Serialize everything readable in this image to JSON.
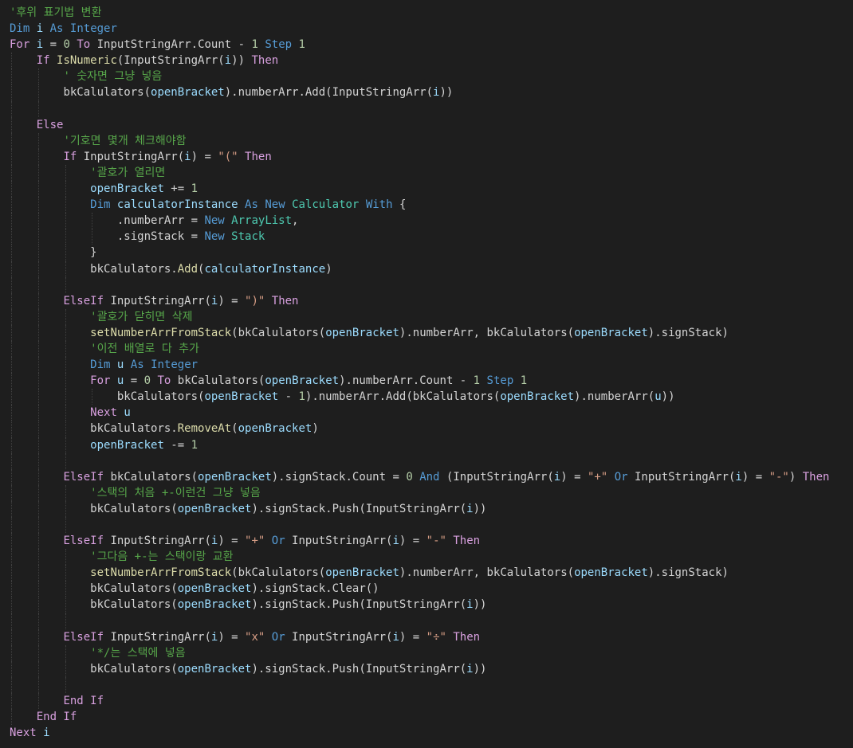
{
  "editor": {
    "language": "Visual Basic",
    "theme": {
      "background": "#1e1e1e",
      "plain": "#d4d4d4",
      "comment": "#57a64a",
      "keyword": "#569cd6",
      "control": "#d8a0df",
      "type": "#4ec9b0",
      "variable": "#9cdcfe",
      "number": "#b5cea8",
      "string": "#d69d85",
      "function": "#dcdcaa"
    },
    "lines": [
      {
        "guides": 0,
        "tokens": [
          [
            "comment",
            "'후위 표기법 변환"
          ]
        ]
      },
      {
        "guides": 0,
        "tokens": [
          [
            "keyword",
            "Dim"
          ],
          [
            "plain",
            " "
          ],
          [
            "variable",
            "i"
          ],
          [
            "plain",
            " "
          ],
          [
            "keyword",
            "As"
          ],
          [
            "plain",
            " "
          ],
          [
            "keyword",
            "Integer"
          ]
        ]
      },
      {
        "guides": 0,
        "tokens": [
          [
            "control",
            "For"
          ],
          [
            "plain",
            " "
          ],
          [
            "variable",
            "i"
          ],
          [
            "plain",
            " = "
          ],
          [
            "number",
            "0"
          ],
          [
            "plain",
            " "
          ],
          [
            "control",
            "To"
          ],
          [
            "plain",
            " InputStringArr.Count - "
          ],
          [
            "number",
            "1"
          ],
          [
            "plain",
            " "
          ],
          [
            "keyword",
            "Step"
          ],
          [
            "plain",
            " "
          ],
          [
            "number",
            "1"
          ]
        ]
      },
      {
        "guides": 1,
        "tokens": [
          [
            "control",
            "If"
          ],
          [
            "plain",
            " "
          ],
          [
            "function",
            "IsNumeric"
          ],
          [
            "plain",
            "(InputStringArr("
          ],
          [
            "variable",
            "i"
          ],
          [
            "plain",
            ")) "
          ],
          [
            "control",
            "Then"
          ]
        ]
      },
      {
        "guides": 2,
        "tokens": [
          [
            "comment",
            "' 숫자면 그냥 넣음"
          ]
        ]
      },
      {
        "guides": 2,
        "tokens": [
          [
            "plain",
            "bkCalulators("
          ],
          [
            "variable",
            "openBracket"
          ],
          [
            "plain",
            ").numberArr.Add(InputStringArr("
          ],
          [
            "variable",
            "i"
          ],
          [
            "plain",
            "))"
          ]
        ]
      },
      {
        "guides": 2,
        "tokens": []
      },
      {
        "guides": 1,
        "tokens": [
          [
            "control",
            "Else"
          ]
        ]
      },
      {
        "guides": 2,
        "tokens": [
          [
            "comment",
            "'기호면 몇개 체크해야함"
          ]
        ]
      },
      {
        "guides": 2,
        "tokens": [
          [
            "control",
            "If"
          ],
          [
            "plain",
            " InputStringArr("
          ],
          [
            "variable",
            "i"
          ],
          [
            "plain",
            ") = "
          ],
          [
            "string",
            "\"(\""
          ],
          [
            "plain",
            " "
          ],
          [
            "control",
            "Then"
          ]
        ]
      },
      {
        "guides": 3,
        "tokens": [
          [
            "comment",
            "'괄호가 열리면"
          ]
        ]
      },
      {
        "guides": 3,
        "tokens": [
          [
            "variable",
            "openBracket"
          ],
          [
            "plain",
            " += "
          ],
          [
            "number",
            "1"
          ]
        ]
      },
      {
        "guides": 3,
        "tokens": [
          [
            "keyword",
            "Dim"
          ],
          [
            "plain",
            " "
          ],
          [
            "variable",
            "calculatorInstance"
          ],
          [
            "plain",
            " "
          ],
          [
            "keyword",
            "As"
          ],
          [
            "plain",
            " "
          ],
          [
            "keyword",
            "New"
          ],
          [
            "plain",
            " "
          ],
          [
            "type",
            "Calculator"
          ],
          [
            "plain",
            " "
          ],
          [
            "keyword",
            "With"
          ],
          [
            "plain",
            " {"
          ]
        ]
      },
      {
        "guides": 4,
        "tokens": [
          [
            "plain",
            ".numberArr = "
          ],
          [
            "keyword",
            "New"
          ],
          [
            "plain",
            " "
          ],
          [
            "type",
            "ArrayList"
          ],
          [
            "plain",
            ","
          ]
        ]
      },
      {
        "guides": 4,
        "tokens": [
          [
            "plain",
            ".signStack = "
          ],
          [
            "keyword",
            "New"
          ],
          [
            "plain",
            " "
          ],
          [
            "type",
            "Stack"
          ]
        ]
      },
      {
        "guides": 3,
        "tokens": [
          [
            "plain",
            "}"
          ]
        ]
      },
      {
        "guides": 3,
        "tokens": [
          [
            "plain",
            "bkCalulators."
          ],
          [
            "function",
            "Add"
          ],
          [
            "plain",
            "("
          ],
          [
            "variable",
            "calculatorInstance"
          ],
          [
            "plain",
            ")"
          ]
        ]
      },
      {
        "guides": 3,
        "tokens": []
      },
      {
        "guides": 2,
        "tokens": [
          [
            "control",
            "ElseIf"
          ],
          [
            "plain",
            " InputStringArr("
          ],
          [
            "variable",
            "i"
          ],
          [
            "plain",
            ") = "
          ],
          [
            "string",
            "\")\""
          ],
          [
            "plain",
            " "
          ],
          [
            "control",
            "Then"
          ]
        ]
      },
      {
        "guides": 3,
        "tokens": [
          [
            "comment",
            "'괄호가 닫히면 삭제"
          ]
        ]
      },
      {
        "guides": 3,
        "tokens": [
          [
            "function",
            "setNumberArrFromStack"
          ],
          [
            "plain",
            "(bkCalulators("
          ],
          [
            "variable",
            "openBracket"
          ],
          [
            "plain",
            ").numberArr, bkCalulators("
          ],
          [
            "variable",
            "openBracket"
          ],
          [
            "plain",
            ").signStack)"
          ]
        ]
      },
      {
        "guides": 3,
        "tokens": [
          [
            "comment",
            "'이전 배열로 다 추가"
          ]
        ]
      },
      {
        "guides": 3,
        "tokens": [
          [
            "keyword",
            "Dim"
          ],
          [
            "plain",
            " "
          ],
          [
            "variable",
            "u"
          ],
          [
            "plain",
            " "
          ],
          [
            "keyword",
            "As"
          ],
          [
            "plain",
            " "
          ],
          [
            "keyword",
            "Integer"
          ]
        ]
      },
      {
        "guides": 3,
        "tokens": [
          [
            "control",
            "For"
          ],
          [
            "plain",
            " "
          ],
          [
            "variable",
            "u"
          ],
          [
            "plain",
            " = "
          ],
          [
            "number",
            "0"
          ],
          [
            "plain",
            " "
          ],
          [
            "control",
            "To"
          ],
          [
            "plain",
            " bkCalulators("
          ],
          [
            "variable",
            "openBracket"
          ],
          [
            "plain",
            ").numberArr.Count - "
          ],
          [
            "number",
            "1"
          ],
          [
            "plain",
            " "
          ],
          [
            "keyword",
            "Step"
          ],
          [
            "plain",
            " "
          ],
          [
            "number",
            "1"
          ]
        ]
      },
      {
        "guides": 4,
        "tokens": [
          [
            "plain",
            "bkCalulators("
          ],
          [
            "variable",
            "openBracket"
          ],
          [
            "plain",
            " - "
          ],
          [
            "number",
            "1"
          ],
          [
            "plain",
            ").numberArr.Add(bkCalulators("
          ],
          [
            "variable",
            "openBracket"
          ],
          [
            "plain",
            ").numberArr("
          ],
          [
            "variable",
            "u"
          ],
          [
            "plain",
            "))"
          ]
        ]
      },
      {
        "guides": 3,
        "tokens": [
          [
            "control",
            "Next"
          ],
          [
            "plain",
            " "
          ],
          [
            "variable",
            "u"
          ]
        ]
      },
      {
        "guides": 3,
        "tokens": [
          [
            "plain",
            "bkCalulators."
          ],
          [
            "function",
            "RemoveAt"
          ],
          [
            "plain",
            "("
          ],
          [
            "variable",
            "openBracket"
          ],
          [
            "plain",
            ")"
          ]
        ]
      },
      {
        "guides": 3,
        "tokens": [
          [
            "variable",
            "openBracket"
          ],
          [
            "plain",
            " -= "
          ],
          [
            "number",
            "1"
          ]
        ]
      },
      {
        "guides": 3,
        "tokens": []
      },
      {
        "guides": 2,
        "tokens": [
          [
            "control",
            "ElseIf"
          ],
          [
            "plain",
            " bkCalulators("
          ],
          [
            "variable",
            "openBracket"
          ],
          [
            "plain",
            ").signStack.Count = "
          ],
          [
            "number",
            "0"
          ],
          [
            "plain",
            " "
          ],
          [
            "keyword",
            "And"
          ],
          [
            "plain",
            " (InputStringArr("
          ],
          [
            "variable",
            "i"
          ],
          [
            "plain",
            ") = "
          ],
          [
            "string",
            "\"+\""
          ],
          [
            "plain",
            " "
          ],
          [
            "keyword",
            "Or"
          ],
          [
            "plain",
            " InputStringArr("
          ],
          [
            "variable",
            "i"
          ],
          [
            "plain",
            ") = "
          ],
          [
            "string",
            "\"-\""
          ],
          [
            "plain",
            ") "
          ],
          [
            "control",
            "Then"
          ]
        ]
      },
      {
        "guides": 3,
        "tokens": [
          [
            "comment",
            "'스택의 처음 +-이런건 그냥 넣음"
          ]
        ]
      },
      {
        "guides": 3,
        "tokens": [
          [
            "plain",
            "bkCalulators("
          ],
          [
            "variable",
            "openBracket"
          ],
          [
            "plain",
            ").signStack.Push(InputStringArr("
          ],
          [
            "variable",
            "i"
          ],
          [
            "plain",
            "))"
          ]
        ]
      },
      {
        "guides": 3,
        "tokens": []
      },
      {
        "guides": 2,
        "tokens": [
          [
            "control",
            "ElseIf"
          ],
          [
            "plain",
            " InputStringArr("
          ],
          [
            "variable",
            "i"
          ],
          [
            "plain",
            ") = "
          ],
          [
            "string",
            "\"+\""
          ],
          [
            "plain",
            " "
          ],
          [
            "keyword",
            "Or"
          ],
          [
            "plain",
            " InputStringArr("
          ],
          [
            "variable",
            "i"
          ],
          [
            "plain",
            ") = "
          ],
          [
            "string",
            "\"-\""
          ],
          [
            "plain",
            " "
          ],
          [
            "control",
            "Then"
          ]
        ]
      },
      {
        "guides": 3,
        "tokens": [
          [
            "comment",
            "'그다음 +-는 스택이랑 교환"
          ]
        ]
      },
      {
        "guides": 3,
        "tokens": [
          [
            "function",
            "setNumberArrFromStack"
          ],
          [
            "plain",
            "(bkCalulators("
          ],
          [
            "variable",
            "openBracket"
          ],
          [
            "plain",
            ").numberArr, bkCalulators("
          ],
          [
            "variable",
            "openBracket"
          ],
          [
            "plain",
            ").signStack)"
          ]
        ]
      },
      {
        "guides": 3,
        "tokens": [
          [
            "plain",
            "bkCalulators("
          ],
          [
            "variable",
            "openBracket"
          ],
          [
            "plain",
            ").signStack.Clear()"
          ]
        ]
      },
      {
        "guides": 3,
        "tokens": [
          [
            "plain",
            "bkCalulators("
          ],
          [
            "variable",
            "openBracket"
          ],
          [
            "plain",
            ").signStack.Push(InputStringArr("
          ],
          [
            "variable",
            "i"
          ],
          [
            "plain",
            "))"
          ]
        ]
      },
      {
        "guides": 3,
        "tokens": []
      },
      {
        "guides": 2,
        "tokens": [
          [
            "control",
            "ElseIf"
          ],
          [
            "plain",
            " InputStringArr("
          ],
          [
            "variable",
            "i"
          ],
          [
            "plain",
            ") = "
          ],
          [
            "string",
            "\"x\""
          ],
          [
            "plain",
            " "
          ],
          [
            "keyword",
            "Or"
          ],
          [
            "plain",
            " InputStringArr("
          ],
          [
            "variable",
            "i"
          ],
          [
            "plain",
            ") = "
          ],
          [
            "string",
            "\"÷\""
          ],
          [
            "plain",
            " "
          ],
          [
            "control",
            "Then"
          ]
        ]
      },
      {
        "guides": 3,
        "tokens": [
          [
            "comment",
            "'*/는 스택에 넣음"
          ]
        ]
      },
      {
        "guides": 3,
        "tokens": [
          [
            "plain",
            "bkCalulators("
          ],
          [
            "variable",
            "openBracket"
          ],
          [
            "plain",
            ").signStack.Push(InputStringArr("
          ],
          [
            "variable",
            "i"
          ],
          [
            "plain",
            "))"
          ]
        ]
      },
      {
        "guides": 3,
        "tokens": []
      },
      {
        "guides": 2,
        "tokens": [
          [
            "control",
            "End If"
          ]
        ]
      },
      {
        "guides": 1,
        "tokens": [
          [
            "control",
            "End If"
          ]
        ]
      },
      {
        "guides": 0,
        "tokens": [
          [
            "control",
            "Next"
          ],
          [
            "plain",
            " "
          ],
          [
            "variable",
            "i"
          ]
        ]
      }
    ]
  }
}
